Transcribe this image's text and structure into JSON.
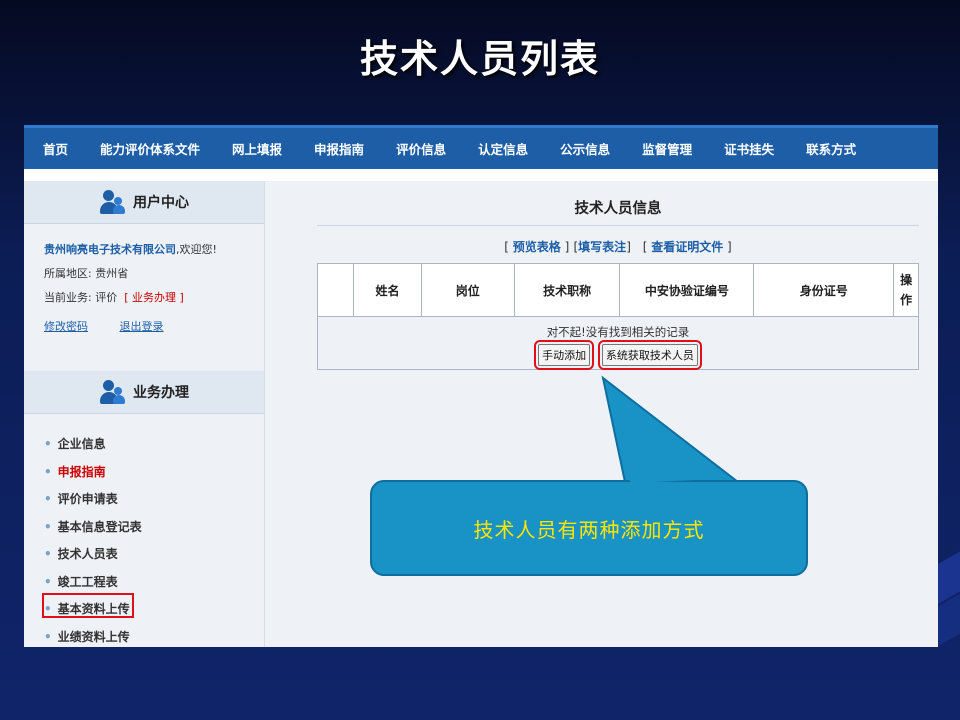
{
  "slide": {
    "title": "技术人员列表"
  },
  "nav": [
    "首页",
    "能力评价体系文件",
    "网上填报",
    "申报指南",
    "评价信息",
    "认定信息",
    "公示信息",
    "监督管理",
    "证书挂失",
    "联系方式"
  ],
  "sidebar": {
    "user_center": "用户中心",
    "company": "贵州响亮电子技术有限公司",
    "welcome": ",欢迎您!",
    "region_label": "所属地区:",
    "region_value": "贵州省",
    "business_label": "当前业务:",
    "business_value": "评价",
    "business_link": "业务办理",
    "change_password": "修改密码",
    "logout": "退出登录",
    "business_center": "业务办理",
    "menu": [
      "企业信息",
      "申报指南",
      "评价申请表",
      "基本信息登记表",
      "技术人员表",
      "竣工工程表",
      "基本资料上传",
      "业绩资料上传"
    ]
  },
  "main": {
    "title": "技术人员信息",
    "links": [
      "预览表格",
      "填写表注",
      "查看证明文件"
    ],
    "columns": [
      "",
      "姓名",
      "岗位",
      "技术职称",
      "中安协验证编号",
      "身份证号",
      "操作"
    ],
    "empty_message": "对不起!没有找到相关的记录",
    "add_manual": "手动添加",
    "add_system": "系统获取技术人员"
  },
  "callout": {
    "text": "技术人员有两种添加方式"
  },
  "colors": {
    "nav": "#1d5ea6",
    "highlight": "#e0101a",
    "callout": "#1992c6",
    "callout_text": "#ffe600"
  }
}
